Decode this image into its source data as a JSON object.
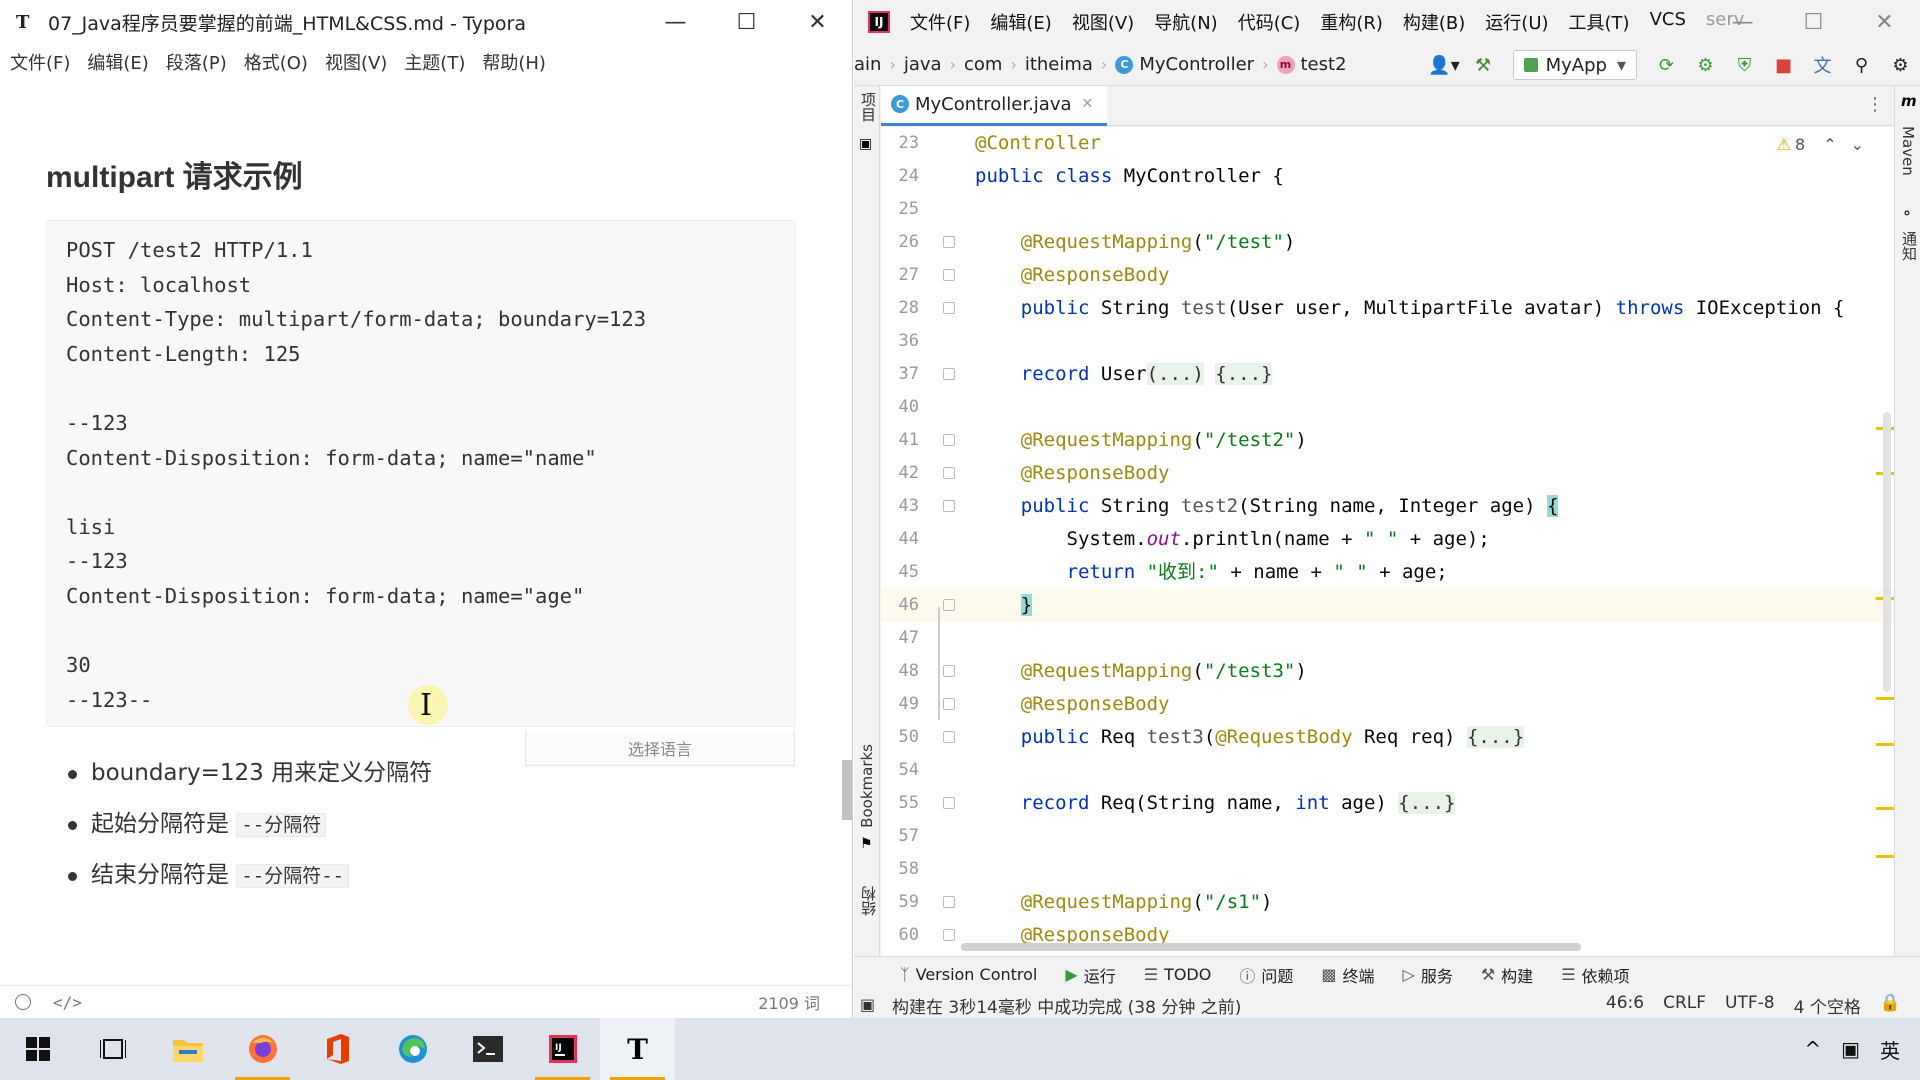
{
  "typora": {
    "title": "07_Java程序员要掌握的前端_HTML&CSS.md - Typora",
    "app_icon": "T",
    "menu": [
      "文件(F)",
      "编辑(E)",
      "段落(P)",
      "格式(O)",
      "视图(V)",
      "主题(T)",
      "帮助(H)"
    ],
    "heading": "multipart 请求示例",
    "code_lines": [
      "POST /test2 HTTP/1.1",
      "Host: localhost",
      "Content-Type: multipart/form-data; boundary=123",
      "Content-Length: 125",
      "",
      "--123",
      "Content-Disposition: form-data; name=\"name\"",
      "",
      "lisi",
      "--123",
      "Content-Disposition: form-data; name=\"age\"",
      "",
      "30",
      "--123--"
    ],
    "lang_select_placeholder": "选择语言",
    "bullets": [
      {
        "text": "boundary=123 用来定义分隔符",
        "code": ""
      },
      {
        "text": "起始分隔符是 ",
        "code": "--分隔符"
      },
      {
        "text": "结束分隔符是 ",
        "code": "--分隔符--"
      }
    ],
    "status": {
      "source_mode_icon": "</>",
      "word_count": "2109 词"
    }
  },
  "idea": {
    "logo": "IJ",
    "menu": [
      "文件(F)",
      "编辑(E)",
      "视图(V)",
      "导航(N)",
      "代码(C)",
      "重构(R)",
      "构建(B)",
      "运行(U)",
      "工具(T)",
      "VCS",
      "serv"
    ],
    "breadcrumbs": [
      "ain",
      "java",
      "com",
      "itheima",
      "MyController",
      "test2"
    ],
    "run_config": "MyApp",
    "tab": {
      "file": "MyController.java",
      "icon": "C"
    },
    "warnings": "8",
    "code": [
      {
        "ln": "23"
      },
      {
        "ln": "24"
      },
      {
        "ln": "25"
      },
      {
        "ln": "26"
      },
      {
        "ln": "27"
      },
      {
        "ln": "28"
      },
      {
        "ln": "36"
      },
      {
        "ln": "37"
      },
      {
        "ln": "40"
      },
      {
        "ln": "41"
      },
      {
        "ln": "42"
      },
      {
        "ln": "43"
      },
      {
        "ln": "44"
      },
      {
        "ln": "45"
      },
      {
        "ln": "46"
      },
      {
        "ln": "47"
      },
      {
        "ln": "48"
      },
      {
        "ln": "49"
      },
      {
        "ln": "50"
      },
      {
        "ln": "54"
      },
      {
        "ln": "55"
      },
      {
        "ln": "57"
      },
      {
        "ln": "58"
      },
      {
        "ln": "59"
      },
      {
        "ln": "60"
      }
    ],
    "left_tools": [
      "项目",
      "Bookmarks",
      "结构"
    ],
    "right_tools": [
      "Maven",
      "通知"
    ],
    "tool_windows": [
      "Version Control",
      "运行",
      "TODO",
      "问题",
      "终端",
      "服务",
      "构建",
      "依赖项"
    ],
    "status": {
      "message": "构建在 3秒14毫秒 中成功完成 (38 分钟 之前)",
      "position": "46:6",
      "line_sep": "CRLF",
      "encoding": "UTF-8",
      "indent": "4 个空格"
    }
  },
  "taskbar": {
    "apps": [
      "start-icon",
      "task-view-icon",
      "file-explorer-icon",
      "firefox-icon",
      "office-icon",
      "edge-icon",
      "terminal-icon",
      "intellij-icon",
      "typora-icon"
    ],
    "tray": {
      "ime": "英",
      "caret": "^"
    }
  }
}
